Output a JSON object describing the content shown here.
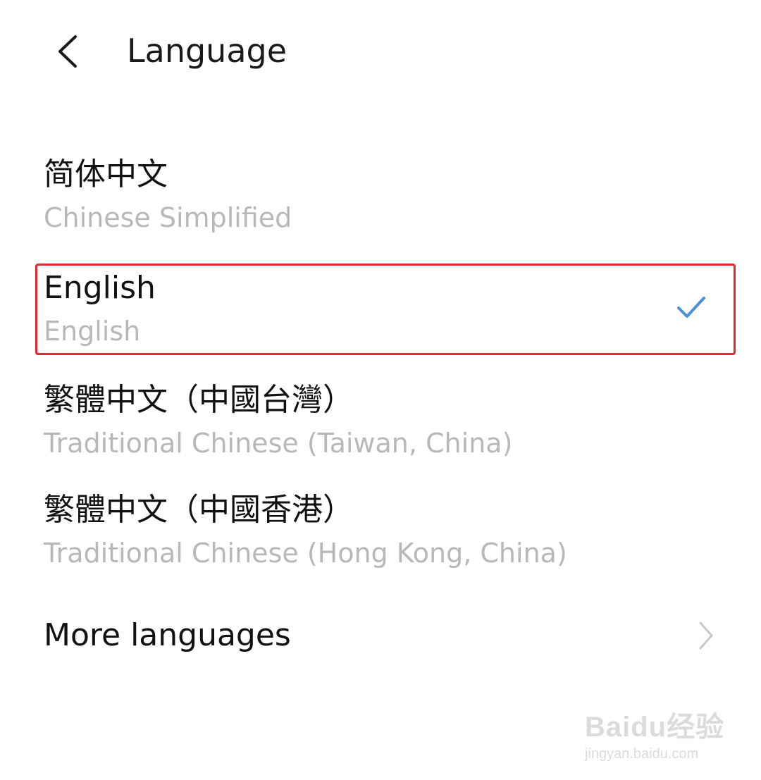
{
  "header": {
    "title": "Language",
    "back_icon": "chevron-left-icon"
  },
  "languages": [
    {
      "name": "简体中文",
      "subtitle": "Chinese Simplified",
      "selected": false
    },
    {
      "name": "English",
      "subtitle": "English",
      "selected": true
    },
    {
      "name": "繁體中文（中國台灣）",
      "subtitle": "Traditional Chinese (Taiwan, China)",
      "selected": false
    },
    {
      "name": "繁體中文（中國香港）",
      "subtitle": "Traditional Chinese (Hong Kong, China)",
      "selected": false
    }
  ],
  "more": {
    "label": "More languages",
    "icon": "chevron-right-icon"
  },
  "watermark": {
    "brand": "Baidu经验",
    "url": "jingyan.baidu.com"
  },
  "colors": {
    "check": "#4a90d9",
    "highlight_border": "#e02b2b",
    "secondary_text": "#b8b8b8"
  }
}
